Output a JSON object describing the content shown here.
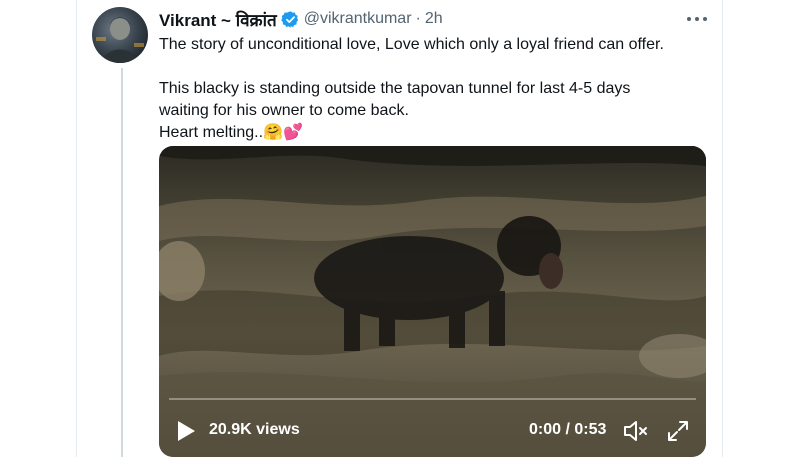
{
  "tweet": {
    "author_name": "Vikrant ~ विक्रांत",
    "handle": "@vikrantkumar",
    "separator": "·",
    "time": "2h",
    "text_line1": "The story of unconditional love, Love which only a loyal friend can offer.",
    "text_line2": "This blacky is standing outside the tapovan tunnel for last 4-5 days",
    "text_line3": "waiting for his owner to come back.",
    "text_line4": "Heart melting..🤗💕"
  },
  "video": {
    "views": "20.9K views",
    "timecode": "0:00 / 0:53",
    "progress": 0
  },
  "icons": {
    "avatar": "avatar",
    "verified": "verified-badge-icon",
    "more": "more-icon",
    "play": "play-icon",
    "volume": "volume-icon",
    "fullscreen": "fullscreen-icon"
  },
  "colors": {
    "verified_blue": "#1d9bf0",
    "text_primary": "#0f1419",
    "text_secondary": "#536471"
  }
}
